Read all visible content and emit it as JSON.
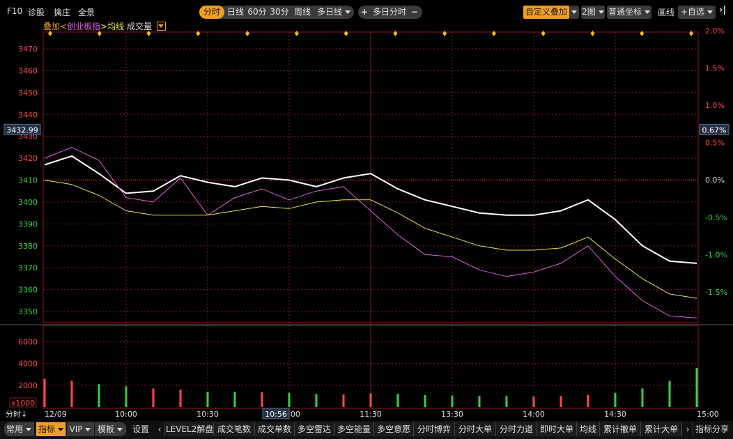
{
  "toolbar": {
    "left_items": [
      "F10",
      "诊股",
      "擒庄",
      "全景"
    ],
    "period_tabs": [
      "分时",
      "日线",
      "60分",
      "30分",
      "周线",
      "多日线"
    ],
    "active_period": "分时",
    "multi_day": {
      "plus": "+",
      "label": "多日分时",
      "minus": "−"
    },
    "overlay_btn": "自定义叠加",
    "layout_btn": "2图",
    "coord_btn": "普通坐标",
    "draw_btn": "画线",
    "watch_btn": "+自选",
    "collapse_icon": "collapse-right-icon"
  },
  "legend": {
    "overlay_label": "叠加<",
    "index_name": "创业板指",
    "avg_label": ">均线",
    "volume_label": "成交量",
    "dropdown_icon": "dropdown-icon"
  },
  "colors": {
    "price": "#ffffff",
    "avg": "#e8e84a",
    "overlay": "#e060e0",
    "grid": "#8a1a1a",
    "up": "#ff4a4a",
    "down": "#3ecf3e",
    "accent": "#f0a020"
  },
  "chart_data": [
    {
      "type": "line",
      "title": "",
      "x": [
        "09:30",
        "09:40",
        "09:50",
        "10:00",
        "10:10",
        "10:20",
        "10:30",
        "10:40",
        "10:50",
        "11:00",
        "11:10",
        "11:20",
        "11:30",
        "13:10",
        "13:20",
        "13:30",
        "13:40",
        "13:50",
        "14:00",
        "14:10",
        "14:20",
        "14:30",
        "14:40",
        "14:50",
        "15:00"
      ],
      "x_tick_labels": [
        "12/09",
        "10:00",
        "10:30",
        "11:00",
        "11:30",
        "13:30",
        "14:00",
        "14:30",
        "15:00"
      ],
      "y_ticks_left": [
        3470,
        3460,
        3450,
        3440,
        3430,
        3420,
        3410,
        3400,
        3390,
        3380,
        3370,
        3360,
        3350
      ],
      "y_ticks_right": [
        "2.0%",
        "1.5%",
        "1.0%",
        "0.5%",
        "0.0%",
        "-0.5%",
        "-1.0%",
        "-1.5%"
      ],
      "ylim": [
        3345,
        3474
      ],
      "prev_close": 3410.1,
      "current_price_label": "3432.99",
      "current_pct_label": "0.67%",
      "crosshair_time_label": "10:56",
      "series": [
        {
          "name": "",
          "key": "price",
          "values": [
            3417,
            3421,
            3413,
            3404,
            3405,
            3412,
            3409,
            3407,
            3411,
            3410,
            3407,
            3411,
            3413,
            3406,
            3401,
            3398,
            3395,
            3394,
            3394,
            3396,
            3401,
            3392,
            3380,
            3373,
            3372
          ]
        },
        {
          "name": "",
          "key": "avg",
          "values": [
            3410,
            3408,
            3403,
            3396,
            3394,
            3394,
            3394,
            3396,
            3398,
            3397,
            3400,
            3401,
            3401,
            3395,
            3388,
            3384,
            3380,
            3378,
            3378,
            3379,
            3384,
            3374,
            3365,
            3358,
            3356
          ]
        },
        {
          "name": "创业板指",
          "key": "overlay",
          "values": [
            3420,
            3425,
            3419,
            3402,
            3400,
            3411,
            3394,
            3402,
            3406,
            3401,
            3405,
            3407,
            3396,
            3385,
            3376,
            3375,
            3369,
            3366,
            3368,
            3372,
            3380,
            3366,
            3355,
            3348,
            3347
          ]
        }
      ]
    },
    {
      "type": "bar",
      "title": "",
      "unit_label": "x1000",
      "y_ticks": [
        6000,
        4000,
        2000
      ],
      "ylim": [
        0,
        7000
      ],
      "x_tick_labels": [
        "12/09",
        "10:00",
        "10:30",
        "11:00",
        "11:30",
        "13:30",
        "14:00",
        "14:30",
        "15:00"
      ],
      "series": [
        {
          "name": "",
          "key": "volume",
          "values": [
            2600,
            2400,
            2100,
            1900,
            1700,
            1600,
            1400,
            1400,
            1350,
            1300,
            1200,
            1150,
            1250,
            1200,
            1100,
            1050,
            1000,
            1000,
            950,
            1000,
            1100,
            1300,
            1700,
            2400,
            3600
          ]
        }
      ]
    }
  ],
  "diamond_markers": 14,
  "bottom": {
    "left_label": "分时",
    "left_arrow": "↓",
    "tabs": [
      "常用",
      "指标",
      "VIP",
      "模板",
      "设置"
    ],
    "active_tab": "指标",
    "scroll_left_icon": "scroll-left-icon",
    "indicator_tabs": [
      "LEVEL2解盘",
      "成交笔数",
      "成交单数",
      "多空雷达",
      "多空能量",
      "多空意愿",
      "分时博弈",
      "分时大单",
      "分时力道",
      "即时大单",
      "均线",
      "累计撤单",
      "累计大单"
    ],
    "scroll_right_icon": "scroll-right-icon",
    "share_btn": "指标分享"
  }
}
